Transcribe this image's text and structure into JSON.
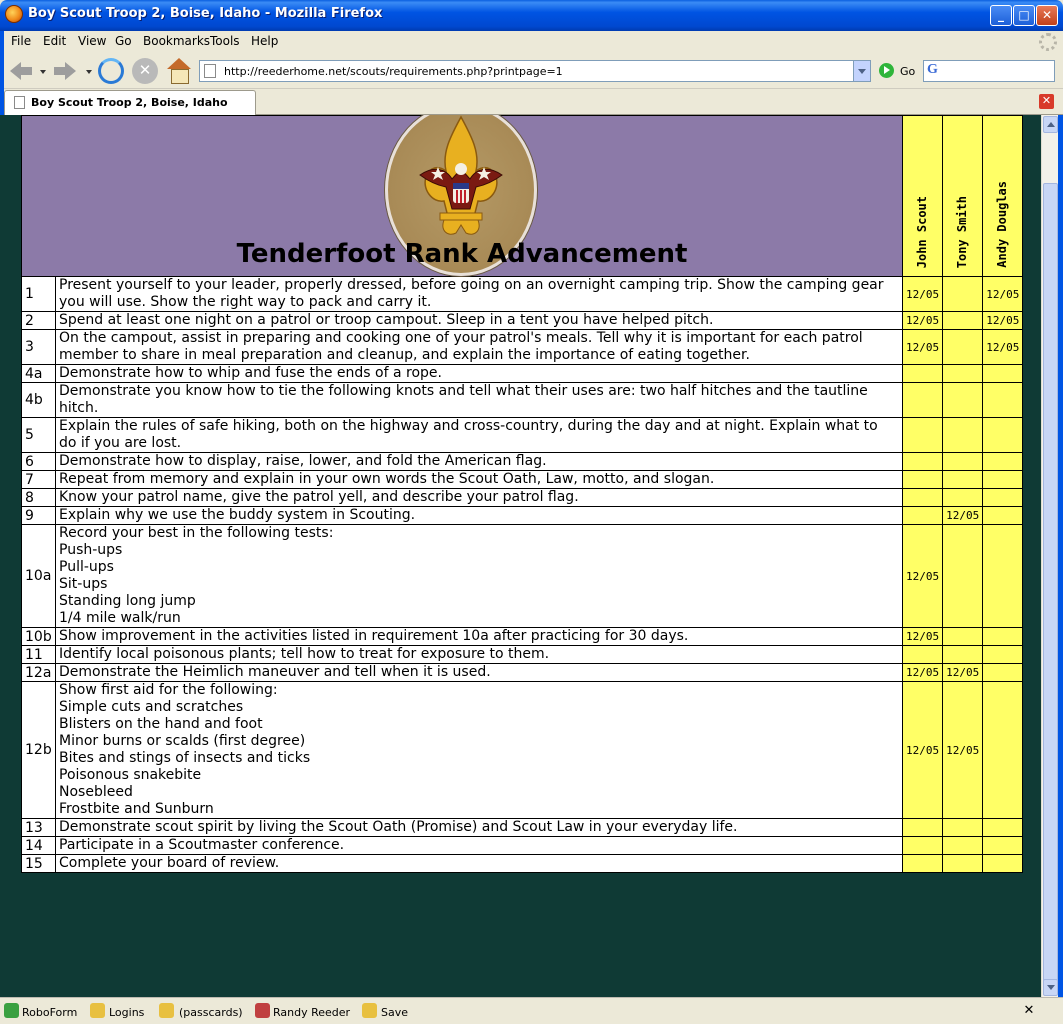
{
  "window": {
    "title": "Boy Scout Troop 2, Boise, Idaho - Mozilla Firefox"
  },
  "menu": [
    "File",
    "Edit",
    "View",
    "Go",
    "Bookmarks",
    "Tools",
    "Help"
  ],
  "nav": {
    "url": "http://reederhome.net/scouts/requirements.php?printpage=1",
    "go_label": "Go"
  },
  "tab": {
    "label": "Boy Scout Troop 2, Boise, Idaho"
  },
  "page": {
    "heading": "Tenderfoot Rank Advancement",
    "scouts": [
      "John Scout",
      "Tony Smith",
      "Andy Douglas"
    ],
    "requirements": [
      {
        "num": "1",
        "text": [
          "Present yourself to your leader, properly dressed, before going on an overnight camping trip. Show the camping gear you will use. Show the right way to pack and carry it."
        ],
        "marks": [
          "12/05",
          "",
          "12/05"
        ]
      },
      {
        "num": "2",
        "text": [
          "Spend at least one night on a patrol or troop campout. Sleep in a tent you have helped pitch."
        ],
        "marks": [
          "12/05",
          "",
          "12/05"
        ]
      },
      {
        "num": "3",
        "text": [
          "On the campout, assist in preparing and cooking one of your patrol's meals. Tell why it is important for each patrol member to share in meal preparation and cleanup, and explain the importance of eating together."
        ],
        "marks": [
          "12/05",
          "",
          "12/05"
        ]
      },
      {
        "num": "4a",
        "text": [
          "Demonstrate how to whip and fuse the ends of a rope."
        ],
        "marks": [
          "",
          "",
          ""
        ]
      },
      {
        "num": "4b",
        "text": [
          "Demonstrate you know how to tie the following knots and tell what their uses are: two half hitches and the tautline hitch."
        ],
        "marks": [
          "",
          "",
          ""
        ]
      },
      {
        "num": "5",
        "text": [
          "Explain the rules of safe hiking, both on the highway and cross-country, during the day and at night. Explain what to do if you are lost."
        ],
        "marks": [
          "",
          "",
          ""
        ]
      },
      {
        "num": "6",
        "text": [
          "Demonstrate how to display, raise, lower, and fold the American flag."
        ],
        "marks": [
          "",
          "",
          ""
        ]
      },
      {
        "num": "7",
        "text": [
          "Repeat from memory and explain in your own words the Scout Oath, Law, motto, and slogan."
        ],
        "marks": [
          "",
          "",
          ""
        ]
      },
      {
        "num": "8",
        "text": [
          "Know your patrol name, give the patrol yell, and describe your patrol flag."
        ],
        "marks": [
          "",
          "",
          ""
        ]
      },
      {
        "num": "9",
        "text": [
          "Explain why we use the buddy system in Scouting."
        ],
        "marks": [
          "",
          "12/05",
          ""
        ]
      },
      {
        "num": "10a",
        "text": [
          "Record your best in the following tests:",
          "Push-ups",
          "Pull-ups",
          "Sit-ups",
          "Standing long jump",
          "1/4 mile walk/run"
        ],
        "marks": [
          "12/05",
          "",
          ""
        ]
      },
      {
        "num": "10b",
        "text": [
          "Show improvement in the activities listed in requirement 10a after practicing for 30 days."
        ],
        "marks": [
          "12/05",
          "",
          ""
        ]
      },
      {
        "num": "11",
        "text": [
          "Identify local poisonous plants; tell how to treat for exposure to them."
        ],
        "marks": [
          "",
          "",
          ""
        ]
      },
      {
        "num": "12a",
        "text": [
          "Demonstrate the Heimlich maneuver and tell when it is used."
        ],
        "marks": [
          "12/05",
          "12/05",
          ""
        ]
      },
      {
        "num": "12b",
        "text": [
          "Show first aid for the following:",
          "Simple cuts and scratches",
          "Blisters on the hand and foot",
          "Minor burns or scalds (first degree)",
          "Bites and stings of insects and ticks",
          "Poisonous snakebite",
          "Nosebleed",
          "Frostbite and Sunburn"
        ],
        "marks": [
          "12/05",
          "12/05",
          ""
        ]
      },
      {
        "num": "13",
        "text": [
          "Demonstrate scout spirit by living the Scout Oath (Promise) and Scout Law in your everyday life."
        ],
        "marks": [
          "",
          "",
          ""
        ]
      },
      {
        "num": "14",
        "text": [
          "Participate in a Scoutmaster conference."
        ],
        "marks": [
          "",
          "",
          ""
        ]
      },
      {
        "num": "15",
        "text": [
          "Complete your board of review."
        ],
        "marks": [
          "",
          "",
          ""
        ]
      }
    ]
  },
  "statusbar": {
    "roboform": "RoboForm",
    "logins": "Logins",
    "passcards": "(passcards)",
    "user": "Randy Reeder",
    "save": "Save"
  },
  "colors": {
    "banner": "#8c7aa8",
    "mark_column": "#ffff66",
    "page_background": "#0f3a35"
  }
}
